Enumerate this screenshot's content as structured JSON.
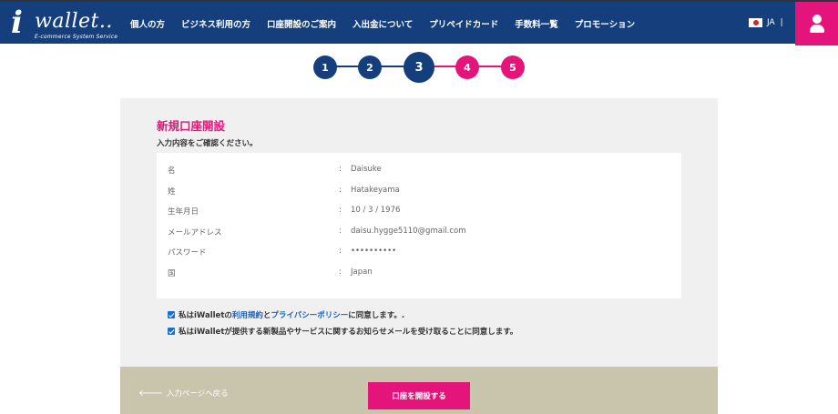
{
  "header": {
    "logo_i": "i",
    "logo_word": "wallet..",
    "logo_tagline": "E-commerce System Service",
    "nav": [
      "個人の方",
      "ビジネス利用の方",
      "口座開設のご案内",
      "入出金について",
      "プリペイドカード",
      "手数料一覧",
      "プロモーション"
    ],
    "lang_label": "JA",
    "lang_sep": "|"
  },
  "steps": [
    {
      "label": "1",
      "state": "done"
    },
    {
      "label": "2",
      "state": "done"
    },
    {
      "label": "3",
      "state": "current"
    },
    {
      "label": "4",
      "state": "todo"
    },
    {
      "label": "5",
      "state": "todo"
    }
  ],
  "form": {
    "title": "新規口座開設",
    "subtitle": "入力内容をご確認ください。",
    "rows": [
      {
        "label": "名",
        "value": "Daisuke"
      },
      {
        "label": "姓",
        "value": "Hatakeyama"
      },
      {
        "label": "生年月日",
        "value": "10 / 3 / 1976"
      },
      {
        "label": "メールアドレス",
        "value": "daisu.hygge5110@gmail.com"
      },
      {
        "label": "パスワード",
        "value": "••••••••••"
      },
      {
        "label": "国",
        "value": "Japan"
      }
    ],
    "colon": ":",
    "consent1": {
      "pre": "私はiWalletの",
      "link1": "利用規約",
      "mid": "と",
      "link2": "プライバシーポリシー",
      "post": "に同意します。."
    },
    "consent2": "私はiWalletが提供する新製品やサービスに関するお知らせメールを受け取ることに同意します。"
  },
  "footer": {
    "back_label": "入力ページへ戻る",
    "submit_label": "口座を開設する"
  },
  "colors": {
    "navy": "#153f7c",
    "pink": "#e5147b",
    "panel": "#f0f0f0",
    "bottom_bar": "#c9c4ac"
  }
}
